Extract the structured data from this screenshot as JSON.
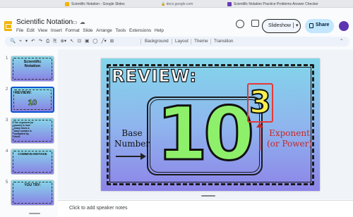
{
  "browser": {
    "tabs": [
      {
        "title": "Scientific Notation - Google Slides",
        "favicon_color": "#f4b400"
      },
      {
        "title": "Scientific Notation Practice Problems Answer Checker",
        "favicon_color": "#673ab7"
      }
    ],
    "url": "docs.google.com"
  },
  "app": {
    "doc_title": "Scientific Notation",
    "menu": [
      "File",
      "Edit",
      "View",
      "Insert",
      "Format",
      "Slide",
      "Arrange",
      "Tools",
      "Extensions",
      "Help"
    ],
    "slideshow_label": "Slideshow",
    "share_label": "Share"
  },
  "toolbar": {
    "background_label": "Background",
    "layout_label": "Layout",
    "theme_label": "Theme",
    "transition_label": "Transition"
  },
  "filmstrip": {
    "slides": [
      {
        "number": "1",
        "title": "Scientific Notation"
      },
      {
        "number": "2",
        "title": "REVIEW:"
      },
      {
        "number": "3",
        "title": "The exponent (or power) is how many times a base number is multiplied by itself."
      },
      {
        "number": "4",
        "title": "COMMON MISTAKE"
      },
      {
        "number": "5",
        "title": "YOU TRY:"
      }
    ],
    "selected": 2
  },
  "slide": {
    "heading": "REVIEW:",
    "base_value": "10",
    "exponent_value": "3",
    "base_label_line1": "Base",
    "base_label_line2": "Number",
    "exponent_label_line1": "Exponent",
    "exponent_label_line2": "(or Power)"
  },
  "notes": {
    "placeholder": "Click to add speaker notes"
  },
  "colors": {
    "accent": "#0b57d0",
    "share_bg": "#c2e7ff",
    "ten_fill": "#8ef06a",
    "exponent_fill": "#f7ef4f",
    "exponent_label": "#c62828"
  }
}
